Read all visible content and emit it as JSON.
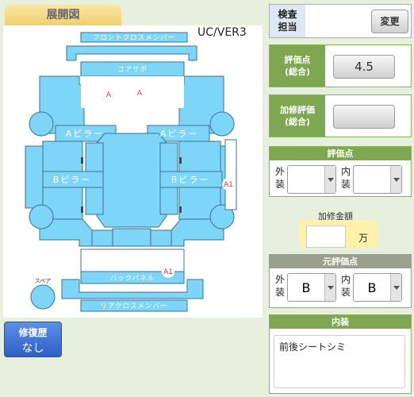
{
  "header": {
    "tab_title": "展開図",
    "version": "UC/VER3"
  },
  "diagram": {
    "parts": {
      "front_cross_member": "フロントクロスメンバー",
      "core_support": "コアサポ",
      "a_pillar_left": "Aピラー",
      "a_pillar_right": "Aピラー",
      "b_pillar_left": "Bピラー",
      "b_pillar_right": "Bピラー",
      "back_panel": "バックパネル",
      "rear_cross_member": "リアクロスメンバー",
      "spare": "スペア"
    },
    "marks": [
      "A",
      "A",
      "A1",
      "A1"
    ]
  },
  "repair_history": {
    "label": "修復歴",
    "value": "なし"
  },
  "inspector": {
    "label": "検査担当",
    "change_label": "変更"
  },
  "score": {
    "label": "評価点(総合)",
    "value": "4.5"
  },
  "repair_score": {
    "label": "加修評価(総合)",
    "value": ""
  },
  "grade": {
    "title": "評価点",
    "exterior_label": "外装",
    "interior_label": "内装",
    "exterior_value": "",
    "interior_value": ""
  },
  "repair_cost": {
    "label": "加修金額",
    "value": "",
    "unit": "万"
  },
  "original_grade": {
    "title": "元評価点",
    "exterior_label": "外装",
    "interior_label": "内装",
    "exterior_value": "B",
    "interior_value": "B"
  },
  "interior_notes": {
    "title": "内装",
    "text": "前後シートシミ"
  },
  "colors": {
    "part_fill": "#7dd6f7",
    "part_stroke": "#3f6f8d",
    "accent_green": "#7fa752",
    "mark_red": "#e03030"
  }
}
